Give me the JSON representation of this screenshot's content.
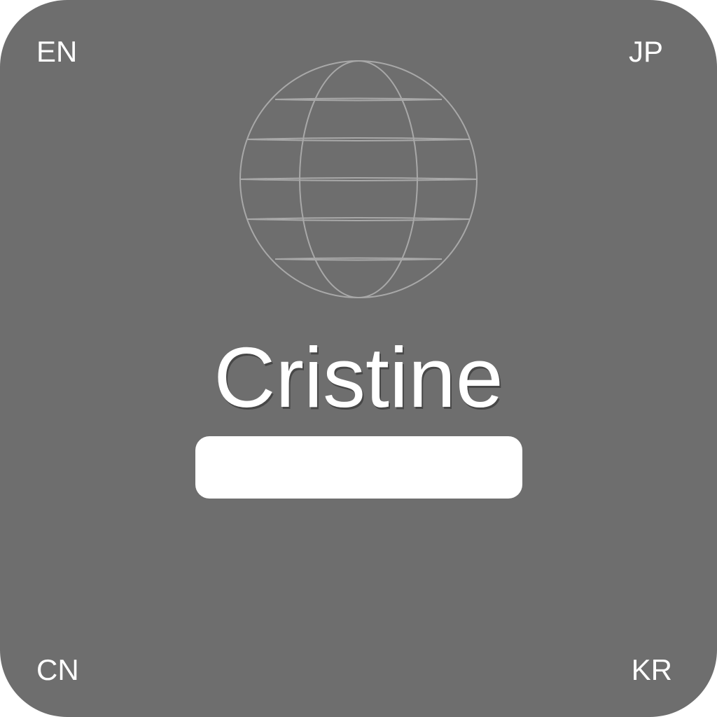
{
  "languages": {
    "top_left": "EN",
    "top_right": "JP",
    "bottom_left": "CN",
    "bottom_right": "KR"
  },
  "profile": {
    "name": "Cristine",
    "name_field_value": ""
  },
  "icons": {
    "center": "globe-icon"
  },
  "colors": {
    "background": "#6e6e6e",
    "text": "#ffffff",
    "globe_stroke": "#a8a8a8",
    "field": "#ffffff"
  }
}
